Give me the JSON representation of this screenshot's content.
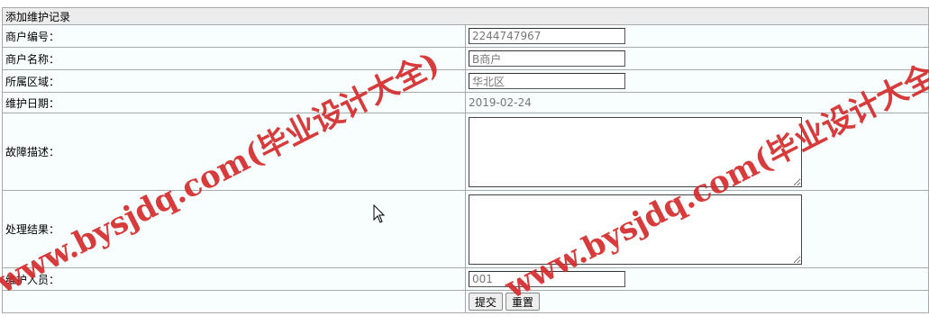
{
  "form": {
    "title": "添加维护记录",
    "merchant_id": {
      "label": "商户编号：",
      "value": "2244747967"
    },
    "merchant_name": {
      "label": "商户名称：",
      "value": "B商户"
    },
    "region": {
      "label": "所属区域：",
      "value": "华北区"
    },
    "date": {
      "label": "维护日期：",
      "value": "2019-02-24"
    },
    "fault": {
      "label": "故障描述：",
      "value": ""
    },
    "result": {
      "label": "处理结果：",
      "value": ""
    },
    "staff": {
      "label": "维护人员：",
      "value": "001"
    },
    "submit_label": "提交",
    "reset_label": "重置"
  },
  "watermark": {
    "text_left": "www.bysjdq.com(毕业设计大全)",
    "text_right": "www.bysjdq.com(毕业设计大全)",
    "color": "#d52b2b"
  }
}
